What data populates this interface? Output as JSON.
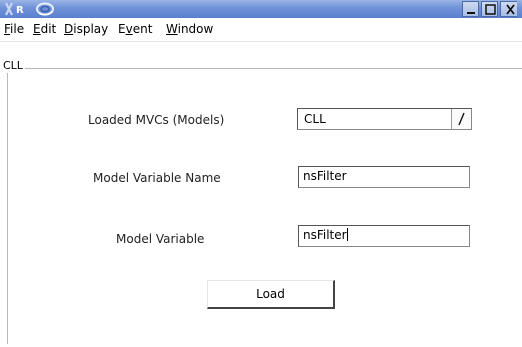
{
  "window": {
    "app_badge": "R",
    "buttons": {
      "minimize": "minimize",
      "maximize": "maximize",
      "close": "close"
    }
  },
  "menu": [
    {
      "label": "File",
      "mnemonic_index": 0
    },
    {
      "label": "Edit",
      "mnemonic_index": 0
    },
    {
      "label": "Display",
      "mnemonic_index": 0
    },
    {
      "label": "Event",
      "mnemonic_index": 1
    },
    {
      "label": "Window",
      "mnemonic_index": 0
    }
  ],
  "group": {
    "title": "CLL"
  },
  "form": {
    "models_label": "Loaded MVCs (Models)",
    "models_selected": "CLL",
    "var_name_label": "Model Variable Name",
    "var_name_value": "nsFilter",
    "var_label": "Model Variable",
    "var_value": "nsFilter"
  },
  "actions": {
    "load_label": "Load"
  },
  "colors": {
    "titlebar": "#6f92d8",
    "border": "#555555"
  }
}
